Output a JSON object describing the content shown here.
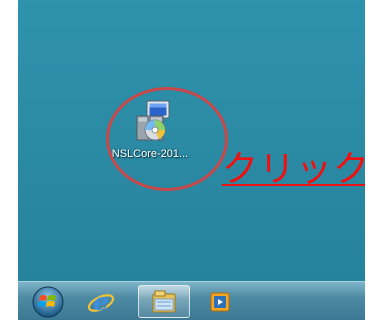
{
  "desktop": {
    "icon": {
      "label": "NSLCore-201...",
      "icon_name": "installer-cd-icon"
    },
    "annotation_text": "クリック",
    "colors": {
      "desktop_bg": "#2b8aa4",
      "circle": "#c8484a",
      "annotation": "#ee1111"
    }
  },
  "taskbar": {
    "items": [
      {
        "name": "start-orb-icon"
      },
      {
        "name": "internet-explorer-icon"
      },
      {
        "name": "file-explorer-icon"
      },
      {
        "name": "media-player-icon"
      }
    ]
  }
}
